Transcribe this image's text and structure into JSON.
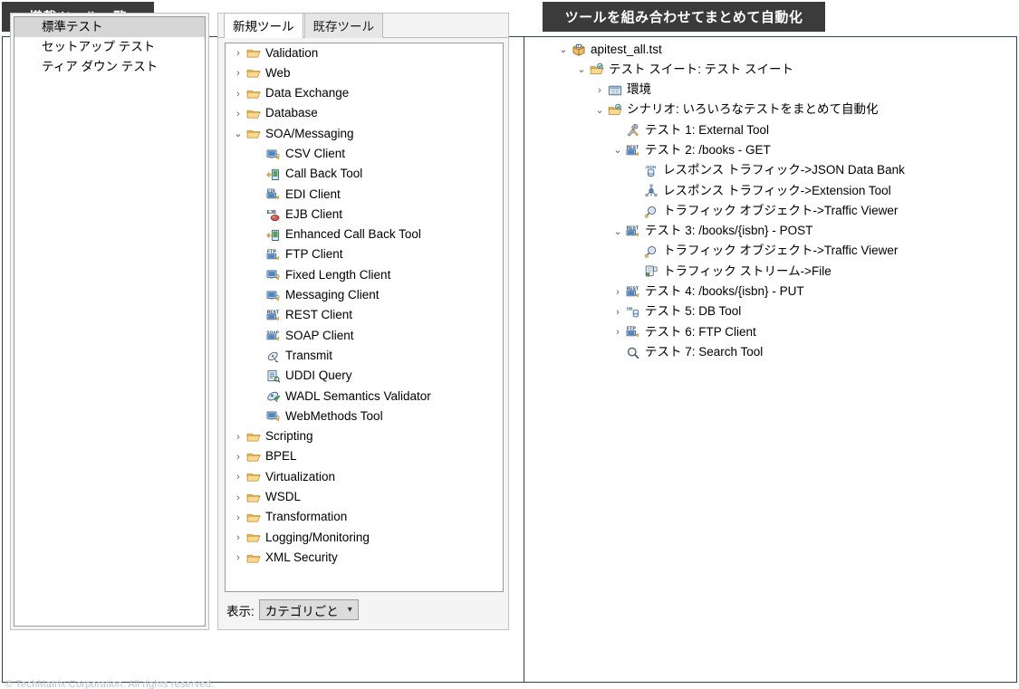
{
  "banners": {
    "left": "搭載ツール一覧",
    "right": "ツールを組み合わせてまとめて自動化"
  },
  "test_type_list": {
    "name": "test-type-list",
    "items": [
      {
        "label": "標準テスト",
        "selected": true
      },
      {
        "label": "セットアップ テスト",
        "selected": false
      },
      {
        "label": "ティア ダウン テスト",
        "selected": false
      }
    ]
  },
  "tool_panel": {
    "tabs": [
      {
        "label": "新規ツール",
        "active": true
      },
      {
        "label": "既存ツール",
        "active": false
      }
    ],
    "display_label": "表示:",
    "display_value": "カテゴリごと",
    "tree": [
      {
        "label": "Validation",
        "icon": "folder-icon",
        "indent": 0,
        "twist": "collapsed"
      },
      {
        "label": "Web",
        "icon": "folder-icon",
        "indent": 0,
        "twist": "collapsed"
      },
      {
        "label": "Data Exchange",
        "icon": "folder-icon",
        "indent": 0,
        "twist": "collapsed"
      },
      {
        "label": "Database",
        "icon": "folder-icon",
        "indent": 0,
        "twist": "collapsed"
      },
      {
        "label": "SOA/Messaging",
        "icon": "folder-icon",
        "indent": 0,
        "twist": "expanded"
      },
      {
        "label": "CSV Client",
        "icon": "client-icon",
        "indent": 1,
        "twist": "none"
      },
      {
        "label": "Call Back Tool",
        "icon": "callback-icon",
        "indent": 1,
        "twist": "none"
      },
      {
        "label": "EDI Client",
        "icon": "edi-client-icon",
        "indent": 1,
        "twist": "none"
      },
      {
        "label": "EJB Client",
        "icon": "ejb-client-icon",
        "indent": 1,
        "twist": "none"
      },
      {
        "label": "Enhanced Call Back Tool",
        "icon": "callback-icon",
        "indent": 1,
        "twist": "none"
      },
      {
        "label": "FTP Client",
        "icon": "ftp-client-icon",
        "indent": 1,
        "twist": "none"
      },
      {
        "label": "Fixed Length Client",
        "icon": "client-icon",
        "indent": 1,
        "twist": "none"
      },
      {
        "label": "Messaging Client",
        "icon": "client-icon",
        "indent": 1,
        "twist": "none"
      },
      {
        "label": "REST Client",
        "icon": "rest-client-icon",
        "indent": 1,
        "twist": "none"
      },
      {
        "label": "SOAP Client",
        "icon": "soap-client-icon",
        "indent": 1,
        "twist": "none"
      },
      {
        "label": "Transmit",
        "icon": "transmit-icon",
        "indent": 1,
        "twist": "none"
      },
      {
        "label": "UDDI Query",
        "icon": "uddi-query-icon",
        "indent": 1,
        "twist": "none"
      },
      {
        "label": "WADL Semantics Validator",
        "icon": "wadl-validator-icon",
        "indent": 1,
        "twist": "none"
      },
      {
        "label": "WebMethods Tool",
        "icon": "client-icon",
        "indent": 1,
        "twist": "none"
      },
      {
        "label": "Scripting",
        "icon": "folder-icon",
        "indent": 0,
        "twist": "collapsed"
      },
      {
        "label": "BPEL",
        "icon": "folder-icon",
        "indent": 0,
        "twist": "collapsed"
      },
      {
        "label": "Virtualization",
        "icon": "folder-icon",
        "indent": 0,
        "twist": "collapsed"
      },
      {
        "label": "WSDL",
        "icon": "folder-icon",
        "indent": 0,
        "twist": "collapsed"
      },
      {
        "label": "Transformation",
        "icon": "folder-icon",
        "indent": 0,
        "twist": "collapsed"
      },
      {
        "label": "Logging/Monitoring",
        "icon": "folder-icon",
        "indent": 0,
        "twist": "collapsed"
      },
      {
        "label": "XML Security",
        "icon": "folder-icon",
        "indent": 0,
        "twist": "collapsed"
      }
    ]
  },
  "scenario_tree": [
    {
      "label": "apitest_all.tst",
      "icon": "tst-file-icon",
      "indent": 0,
      "twist": "expanded"
    },
    {
      "label": "テスト スイート: テスト スイート",
      "icon": "test-suite-icon",
      "indent": 1,
      "twist": "expanded"
    },
    {
      "label": "環境",
      "icon": "environment-icon",
      "indent": 2,
      "twist": "collapsed"
    },
    {
      "label": "シナリオ: いろいろなテストをまとめて自動化",
      "icon": "test-suite-icon",
      "indent": 2,
      "twist": "expanded"
    },
    {
      "label": "テスト 1: External Tool",
      "icon": "external-tool-icon",
      "indent": 3,
      "twist": "none"
    },
    {
      "label": "テスト 2: /books - GET",
      "icon": "rest-client-icon",
      "indent": 3,
      "twist": "expanded"
    },
    {
      "label": "レスポンス トラフィック->JSON Data Bank",
      "icon": "json-databank-icon",
      "indent": 4,
      "twist": "none"
    },
    {
      "label": "レスポンス トラフィック->Extension Tool",
      "icon": "extension-tool-icon",
      "indent": 4,
      "twist": "none"
    },
    {
      "label": "トラフィック オブジェクト->Traffic Viewer",
      "icon": "traffic-viewer-icon",
      "indent": 4,
      "twist": "none"
    },
    {
      "label": "テスト 3: /books/{isbn} - POST",
      "icon": "rest-client-icon",
      "indent": 3,
      "twist": "expanded"
    },
    {
      "label": "トラフィック オブジェクト->Traffic Viewer",
      "icon": "traffic-viewer-icon",
      "indent": 4,
      "twist": "none"
    },
    {
      "label": "トラフィック ストリーム->File",
      "icon": "traffic-stream-icon",
      "indent": 4,
      "twist": "none"
    },
    {
      "label": "テスト 4: /books/{isbn} - PUT",
      "icon": "rest-client-icon",
      "indent": 3,
      "twist": "collapsed"
    },
    {
      "label": "テスト 5: DB Tool",
      "icon": "db-tool-icon",
      "indent": 3,
      "twist": "collapsed"
    },
    {
      "label": "テスト 6: FTP Client",
      "icon": "ftp-client-icon",
      "indent": 3,
      "twist": "collapsed"
    },
    {
      "label": "テスト 7: Search Tool",
      "icon": "search-tool-icon",
      "indent": 3,
      "twist": "none"
    }
  ],
  "watermark": "© TechMatrix Corporation. All rights reserved.",
  "colors": {
    "banner_bg": "#3b3b3b",
    "banner_text": "#ffffff",
    "frame_border": "#2c4257",
    "selection": "#d6d6d6",
    "folder": "#e8a33d"
  }
}
